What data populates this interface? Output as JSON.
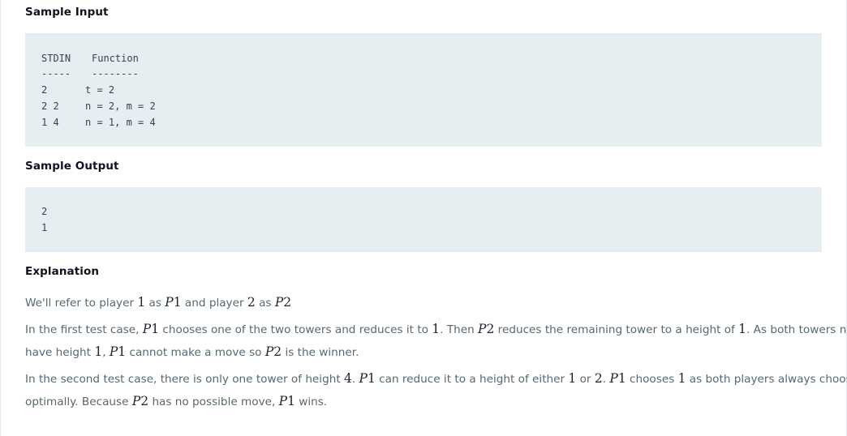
{
  "sample_input": {
    "heading": "Sample Input",
    "columns": [
      "STDIN",
      "Function"
    ],
    "dashes": [
      "-----",
      "--------"
    ],
    "rows": [
      {
        "stdin": "2",
        "function": "t = 2"
      },
      {
        "stdin": "2 2",
        "function": "n = 2, m = 2"
      },
      {
        "stdin": "1 4",
        "function": "n = 1, m = 4"
      }
    ]
  },
  "sample_output": {
    "heading": "Sample Output",
    "lines": [
      "2",
      "1"
    ]
  },
  "explanation": {
    "heading": "Explanation",
    "p1": {
      "t1": "We'll refer to player ",
      "m1": "1",
      "t2": " as ",
      "m2v": "P",
      "m2n": "1",
      "t3": " and player ",
      "m3": "2",
      "t4": " as ",
      "m4v": "P",
      "m4n": "2"
    },
    "p2_line1": {
      "t1": "In the first test case, ",
      "m1v": "P",
      "m1n": "1",
      "t2": " chooses one of the two towers and reduces it to ",
      "m2": "1",
      "t3": ". Then ",
      "m3v": "P",
      "m3n": "2",
      "t4": " reduces the remaining tower to a height of ",
      "m4": "1",
      "t5": ". As both towers now"
    },
    "p2_line2": {
      "t1": "have height ",
      "m1": "1",
      "t2": ", ",
      "m2v": "P",
      "m2n": "1",
      "t3": " cannot make a move so ",
      "m3v": "P",
      "m3n": "2",
      "t4": " is the winner."
    },
    "p3_line1": {
      "t1": "In the second test case, there is only one tower of height ",
      "m1": "4",
      "t2": ". ",
      "m2v": "P",
      "m2n": "1",
      "t3": " can reduce it to a height of either ",
      "m3": "1",
      "t4": " or ",
      "m4": "2",
      "t5": ". ",
      "m5v": "P",
      "m5n": "1",
      "t6": " chooses ",
      "m6": "1",
      "t7": " as both players always choose"
    },
    "p3_line2": {
      "t1": "optimally. Because ",
      "m1v": "P",
      "m1n": "2",
      "t2": " has no possible move, ",
      "m2v": "P",
      "m2n": "1",
      "t3": " wins."
    }
  }
}
